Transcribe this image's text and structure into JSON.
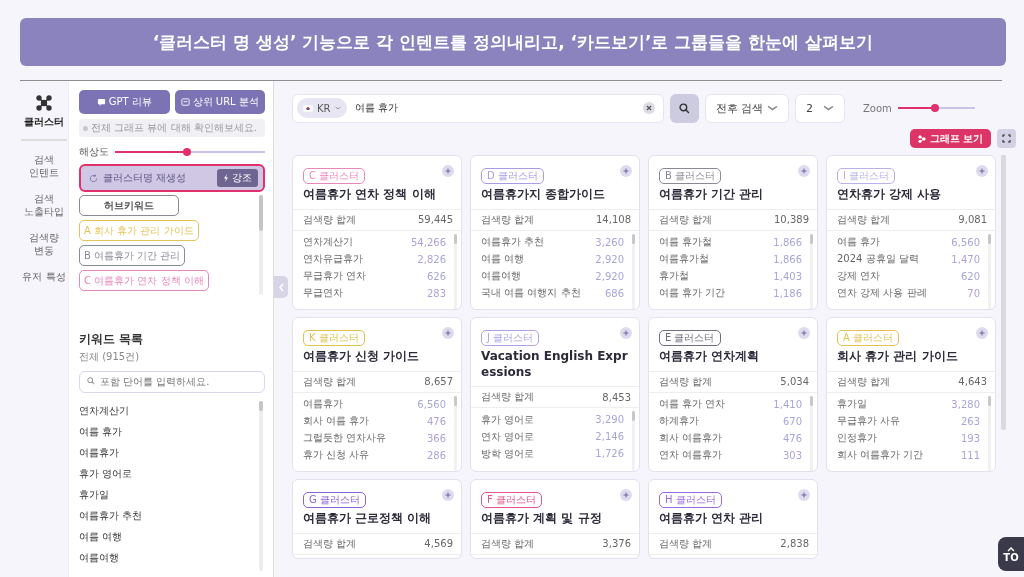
{
  "banner": {
    "title": "‘클러스터 명 생성’ 기능으로 각 인텐트를 정의내리고, ‘카드보기’로 그룹들을 한눈에 살펴보기"
  },
  "nav": {
    "items": [
      {
        "label": "클러스터",
        "selected": true
      },
      {
        "label": "검색 인텐트",
        "selected": false
      },
      {
        "label": "검색 노출타입",
        "selected": false
      },
      {
        "label": "검색량 변동",
        "selected": false
      },
      {
        "label": "유저 특성",
        "selected": false
      }
    ]
  },
  "sidebar": {
    "buttons": [
      "GPT 리뷰",
      "상위 URL 분석"
    ],
    "info": "전체 그래프 뷰에 대해 확인해보세요.",
    "resolution": {
      "label": "해상도",
      "level": 0.48
    },
    "regenerate": {
      "label": "클러스터명 재생성",
      "button": "강조",
      "highlighted": true
    },
    "clusters": [
      {
        "label": "허브키워드",
        "color": "#8a8a96"
      },
      {
        "label": "A 회사 휴가 관리 가이드",
        "color": "#e3c357"
      },
      {
        "label": "B 여름휴가 기간 관리",
        "color": "#8a8a96"
      },
      {
        "label": "C 여름휴가 연차 정책 이해",
        "color": "#e987bd"
      }
    ],
    "keywords": {
      "title": "키워드 목록",
      "count": "전체 (915건)",
      "placeholder": "포함 단어를 입력하세요.",
      "items": [
        "연차계산기",
        "여름 휴가",
        "여름휴가",
        "휴가 영어로",
        "휴가일",
        "여름휴가 추천",
        "여름 여행",
        "여름여행"
      ]
    }
  },
  "toolbar": {
    "country": "KR",
    "query": "여름 휴가",
    "mode": "전후 검색",
    "depth": "2",
    "zoom_label": "Zoom",
    "zoom": {
      "level": 0.48
    },
    "graph_button": "그래프 보기"
  },
  "cards": [
    {
      "badge": "C 클러스터",
      "color": "#e987bd",
      "title": "여름휴가 연차 정책 이해",
      "sum_label": "검색량 합계",
      "sum": "59,445",
      "rows": [
        [
          "연차계산기",
          "54,266"
        ],
        [
          "연차유급휴가",
          "2,826"
        ],
        [
          "무급휴가 연차",
          "626"
        ],
        [
          "무급연차",
          "283"
        ]
      ]
    },
    {
      "badge": "D 클러스터",
      "color": "#a79ce6",
      "title": "여름휴가지 종합가이드",
      "sum_label": "검색량 합계",
      "sum": "14,108",
      "rows": [
        [
          "여름휴가 추천",
          "3,260"
        ],
        [
          "여름 여행",
          "2,920"
        ],
        [
          "여름여행",
          "2,920"
        ],
        [
          "국내 여름 여행지 추천",
          "686"
        ]
      ]
    },
    {
      "badge": "B 클러스터",
      "color": "#8a8a96",
      "title": "여름휴가 기간 관리",
      "sum_label": "검색량 합계",
      "sum": "10,389",
      "rows": [
        [
          "여름 휴가철",
          "1,866"
        ],
        [
          "여름휴가철",
          "1,866"
        ],
        [
          "휴가철",
          "1,403"
        ],
        [
          "여름 휴가 기간",
          "1,186"
        ]
      ]
    },
    {
      "badge": "I 클러스터",
      "color": "#b8b2ea",
      "title": "연차휴가 강제 사용",
      "sum_label": "검색량 합계",
      "sum": "9,081",
      "rows": [
        [
          "여름 휴가",
          "6,560"
        ],
        [
          "2024 공휴일 달력",
          "1,470"
        ],
        [
          "강제 연차",
          "620"
        ],
        [
          "연차 강제 사용 판례",
          "70"
        ]
      ]
    },
    {
      "badge": "K 클러스터",
      "color": "#dcc24e",
      "title": "여름휴가 신청 가이드",
      "sum_label": "검색량 합계",
      "sum": "8,657",
      "rows": [
        [
          "여름휴가",
          "6,560"
        ],
        [
          "회사 여름 휴가",
          "476"
        ],
        [
          "그럴듯한 연차사유",
          "366"
        ],
        [
          "휴가 신청 사유",
          "286"
        ]
      ]
    },
    {
      "badge": "J 클러스터",
      "color": "#aaa4e6",
      "title": "Vacation English Expressions",
      "sum_label": "검색량 합계",
      "sum": "8,453",
      "rows": [
        [
          "휴가 영어로",
          "3,290"
        ],
        [
          "연차 영어로",
          "2,146"
        ],
        [
          "방학 영어로",
          "1,726"
        ]
      ]
    },
    {
      "badge": "E 클러스터",
      "color": "#6e6e7c",
      "title": "여름휴가 연차계획",
      "sum_label": "검색량 합계",
      "sum": "5,034",
      "rows": [
        [
          "여름 휴가 연차",
          "1,410"
        ],
        [
          "하계휴가",
          "670"
        ],
        [
          "회사 여름휴가",
          "476"
        ],
        [
          "연차 여름휴가",
          "303"
        ]
      ]
    },
    {
      "badge": "A 클러스터",
      "color": "#e3c357",
      "title": "회사 휴가 관리 가이드",
      "sum_label": "검색량 합계",
      "sum": "4,643",
      "rows": [
        [
          "휴가일",
          "3,280"
        ],
        [
          "무급휴가 사유",
          "263"
        ],
        [
          "인정휴가",
          "193"
        ],
        [
          "회사 여름휴가 기간",
          "111"
        ]
      ]
    },
    {
      "badge": "G 클러스터",
      "color": "#8b63d9",
      "title": "여름휴가 근로정책 이해",
      "sum_label": "검색량 합계",
      "sum": "4,569"
    },
    {
      "badge": "F 클러스터",
      "color": "#e4558a",
      "title": "여름휴가 계획 및 규정",
      "sum_label": "검색량 합계",
      "sum": "3,376"
    },
    {
      "badge": "H 클러스터",
      "color": "#9a6ae0",
      "title": "여름휴가 연차 관리",
      "sum_label": "검색량 합계",
      "sum": "2,838"
    }
  ],
  "top_button": "TO"
}
